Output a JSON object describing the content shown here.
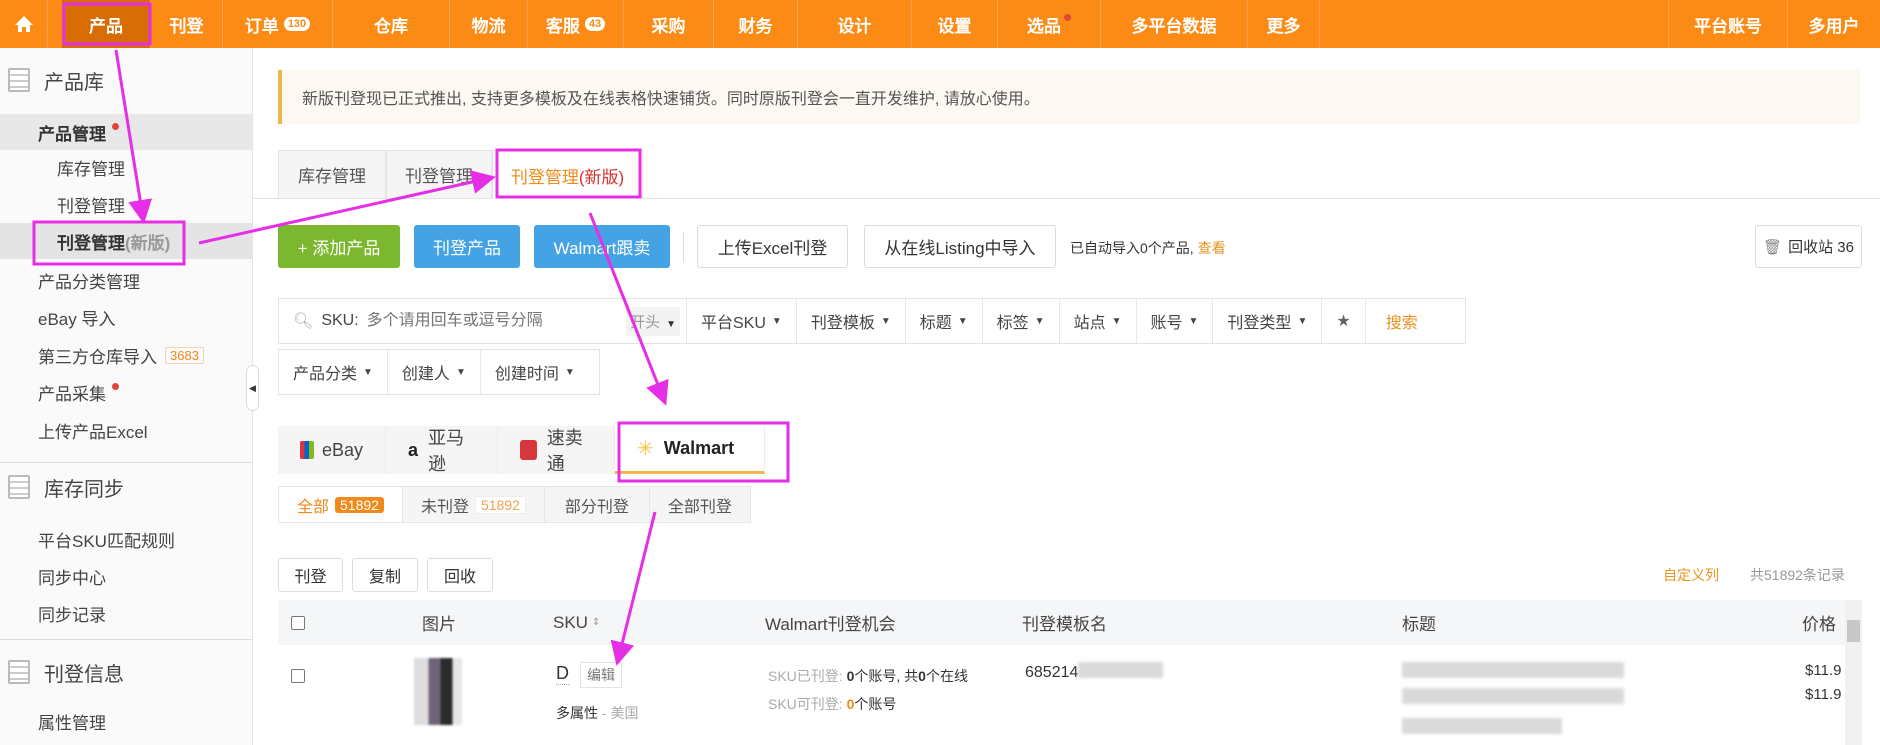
{
  "topnav": {
    "items": [
      {
        "label": "产品"
      },
      {
        "label": "刊登"
      },
      {
        "label": "订单",
        "badge": "130"
      },
      {
        "label": "仓库"
      },
      {
        "label": "物流"
      },
      {
        "label": "客服",
        "badge": "43"
      },
      {
        "label": "采购"
      },
      {
        "label": "财务"
      },
      {
        "label": "设计"
      },
      {
        "label": "设置"
      },
      {
        "label": "选品"
      },
      {
        "label": "多平台数据"
      },
      {
        "label": "更多"
      }
    ],
    "right": [
      "平台账号",
      "多用户"
    ]
  },
  "sidebar": {
    "sections": [
      {
        "title": "产品库",
        "items": [
          "产品管理",
          "库存管理",
          "刊登管理",
          "刊登管理",
          "产品分类管理",
          "eBay 导入",
          "第三方仓库导入",
          "产品采集",
          "上传产品Excel"
        ],
        "new_suffix": "(新版)",
        "badge": "3683"
      },
      {
        "title": "库存同步",
        "items": [
          "平台SKU匹配规则",
          "同步中心",
          "同步记录"
        ]
      },
      {
        "title": "刊登信息",
        "items": [
          "属性管理"
        ]
      }
    ]
  },
  "notice": "新版刊登现已正式推出, 支持更多模板及在线表格快速铺货。同时原版刊登会一直开发维护, 请放心使用。",
  "tabs": [
    "库存管理",
    "刊登管理",
    "刊登管理",
    "(新版)"
  ],
  "toolbar": {
    "add": "+ 添加产品",
    "publish": "刊登产品",
    "walmart_follow": "Walmart跟卖",
    "upload_excel": "上传Excel刊登",
    "import_listing": "从在线Listing中导入",
    "auto_import": "已自动导入0个产品,",
    "view": "查看",
    "recycle": "回收站 36"
  },
  "filters": {
    "search_label": "SKU:",
    "search_placeholder": "多个请用回车或逗号分隔",
    "match": "开头",
    "row1": [
      "平台SKU",
      "刊登模板",
      "标题",
      "标签",
      "站点",
      "账号",
      "刊登类型"
    ],
    "search_btn": "搜索",
    "row2": [
      "产品分类",
      "创建人",
      "创建时间"
    ]
  },
  "platforms": [
    "eBay",
    "亚马逊",
    "速卖通",
    "Walmart"
  ],
  "status_tabs": [
    {
      "label": "全部",
      "count": "51892"
    },
    {
      "label": "未刊登",
      "count": "51892"
    },
    {
      "label": "部分刊登"
    },
    {
      "label": "全部刊登"
    }
  ],
  "actions": [
    "刊登",
    "复制",
    "回收"
  ],
  "custom_cols": "自定义列",
  "total": "共51892条记录",
  "table": {
    "headers": [
      "图片",
      "SKU",
      "Walmart刊登机会",
      "刊登模板名",
      "标题",
      "价格"
    ],
    "rows": [
      {
        "sku": "D",
        "edit": "编辑",
        "attr": "多属性",
        "site": "- 美国",
        "listed_label": "SKU已刊登:",
        "listed_n": "0",
        "listed_rest": "个账号, 共",
        "online_n": "0",
        "online_rest": "个在线",
        "avail_label": "SKU可刊登:",
        "avail_n": "0",
        "avail_rest": "个账号",
        "template": "685214",
        "prices": [
          "$11.9",
          "$11.9"
        ]
      }
    ]
  },
  "colors": {
    "brand": "#fb8b14",
    "annotation": "#e62ee6"
  }
}
